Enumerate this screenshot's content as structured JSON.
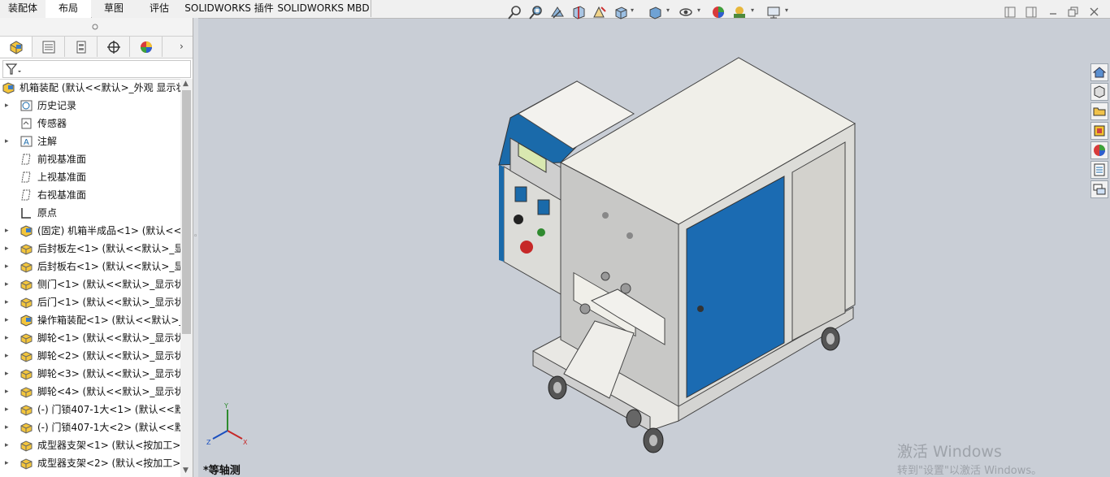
{
  "ribbon_tabs": [
    "装配体",
    "布局",
    "草图",
    "评估",
    "SOLIDWORKS 插件",
    "SOLIDWORKS MBD"
  ],
  "active_tab": "布局",
  "view_toolbar": [
    "zoom-to-fit-icon",
    "zoom-area-icon",
    "previous-view-icon",
    "section-view-icon",
    "dynamic-annotation-icon",
    "view-orientation-icon",
    "display-style-icon",
    "hide-show-icon",
    "edit-appearance-icon",
    "apply-scene-icon",
    "view-settings-icon"
  ],
  "panel_tabs": [
    "feature-manager-icon",
    "property-manager-icon",
    "configuration-manager-icon",
    "dimxpert-icon",
    "display-manager-icon"
  ],
  "tree": [
    {
      "label": "机箱装配  (默认<<默认>_外观 显示状",
      "icon": "assembly-icon",
      "arrow": "",
      "indent": 0
    },
    {
      "label": "历史记录",
      "icon": "history-icon",
      "arrow": "▸",
      "indent": 1
    },
    {
      "label": "传感器",
      "icon": "sensor-icon",
      "arrow": "",
      "indent": 1
    },
    {
      "label": "注解",
      "icon": "annotation-icon",
      "arrow": "▸",
      "indent": 1
    },
    {
      "label": "前视基准面",
      "icon": "plane-icon",
      "arrow": "",
      "indent": 1
    },
    {
      "label": "上视基准面",
      "icon": "plane-icon",
      "arrow": "",
      "indent": 1
    },
    {
      "label": "右视基准面",
      "icon": "plane-icon",
      "arrow": "",
      "indent": 1
    },
    {
      "label": "原点",
      "icon": "origin-icon",
      "arrow": "",
      "indent": 1
    },
    {
      "label": "(固定) 机箱半成品<1> (默认<<默",
      "icon": "subassembly-icon",
      "arrow": "▸",
      "indent": 1
    },
    {
      "label": "后封板左<1> (默认<<默认>_显",
      "icon": "part-icon",
      "arrow": "▸",
      "indent": 1
    },
    {
      "label": "后封板右<1> (默认<<默认>_显",
      "icon": "part-icon",
      "arrow": "▸",
      "indent": 1
    },
    {
      "label": "侧门<1> (默认<<默认>_显示状",
      "icon": "part-icon",
      "arrow": "▸",
      "indent": 1
    },
    {
      "label": "后门<1> (默认<<默认>_显示状",
      "icon": "part-icon",
      "arrow": "▸",
      "indent": 1
    },
    {
      "label": "操作箱装配<1> (默认<<默认>_",
      "icon": "subassembly-icon",
      "arrow": "▸",
      "indent": 1
    },
    {
      "label": "脚轮<1> (默认<<默认>_显示状",
      "icon": "part-icon",
      "arrow": "▸",
      "indent": 1
    },
    {
      "label": "脚轮<2> (默认<<默认>_显示状",
      "icon": "part-icon",
      "arrow": "▸",
      "indent": 1
    },
    {
      "label": "脚轮<3> (默认<<默认>_显示状",
      "icon": "part-icon",
      "arrow": "▸",
      "indent": 1
    },
    {
      "label": "脚轮<4> (默认<<默认>_显示状",
      "icon": "part-icon",
      "arrow": "▸",
      "indent": 1
    },
    {
      "label": "(-) 门锁407-1大<1> (默认<<默",
      "icon": "part-icon",
      "arrow": "▸",
      "indent": 1
    },
    {
      "label": "(-) 门锁407-1大<2> (默认<<默",
      "icon": "part-icon",
      "arrow": "▸",
      "indent": 1
    },
    {
      "label": "成型器支架<1> (默认<按加工>",
      "icon": "part-icon",
      "arrow": "▸",
      "indent": 1
    },
    {
      "label": "成型器支架<2> (默认<按加工>",
      "icon": "part-icon",
      "arrow": "▸",
      "indent": 1
    }
  ],
  "task_pane": [
    "home-icon",
    "3d-content-icon",
    "folder-icon",
    "design-library-icon",
    "appearances-icon",
    "custom-properties-icon",
    "forum-icon"
  ],
  "view_name": "*等轴测",
  "watermark": {
    "line1": "激活 Windows",
    "line2": "转到\"设置\"以激活 Windows。"
  },
  "triad": {
    "x": "X",
    "y": "Y",
    "z": "Z"
  },
  "colors": {
    "accent_blue": "#1a6aaa",
    "viewport_bg": "#c9ced6",
    "door_blue": "#1b6bb2"
  }
}
